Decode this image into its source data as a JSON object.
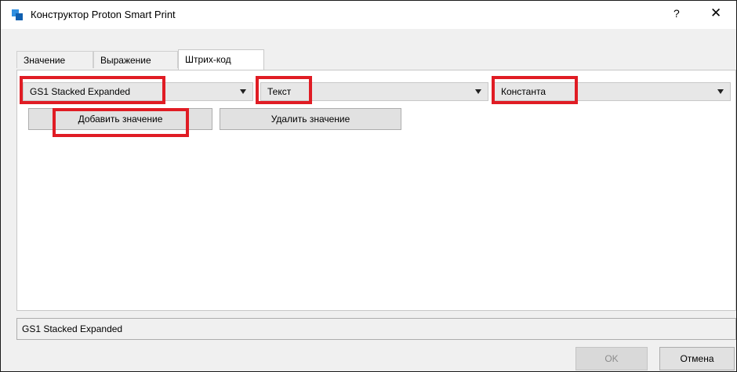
{
  "window": {
    "title": "Конструктор Proton Smart Print",
    "help_label": "?",
    "close_label": "✕"
  },
  "tabs": [
    {
      "label": "Значение"
    },
    {
      "label": "Выражение"
    },
    {
      "label": "Штрих-код"
    }
  ],
  "barcode": {
    "type_value": "GS1 Stacked Expanded",
    "data_type_value": "Текст",
    "source_value": "Константа",
    "add_value_label": "Добавить значение",
    "delete_value_label": "Удалить значение"
  },
  "status": {
    "text": "GS1 Stacked Expanded"
  },
  "footer": {
    "ok_label": "OK",
    "cancel_label": "Отмена"
  },
  "colors": {
    "highlight": "#e01c24",
    "app_icon": "#2f8fe0"
  }
}
